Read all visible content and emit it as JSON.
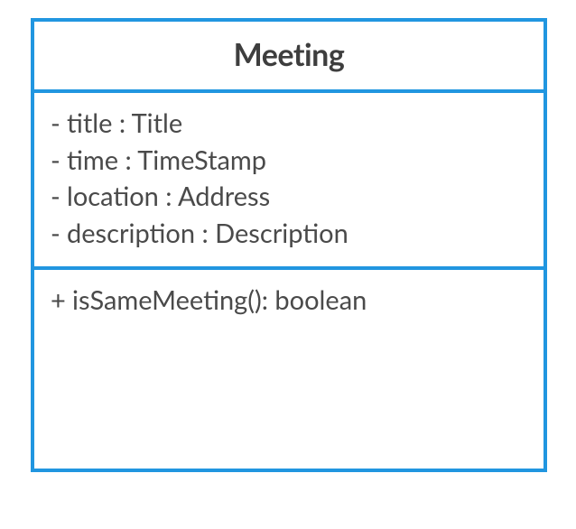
{
  "class": {
    "name": "Meeting",
    "attributes": [
      {
        "vis": "-",
        "text": "title : Title"
      },
      {
        "vis": "-",
        "text": "time : TimeStamp"
      },
      {
        "vis": "-",
        "text": "location : Address"
      },
      {
        "vis": "-",
        "text": "description : Description"
      }
    ],
    "methods": [
      {
        "vis": "+",
        "text": "isSameMeeting(): boolean"
      }
    ]
  }
}
